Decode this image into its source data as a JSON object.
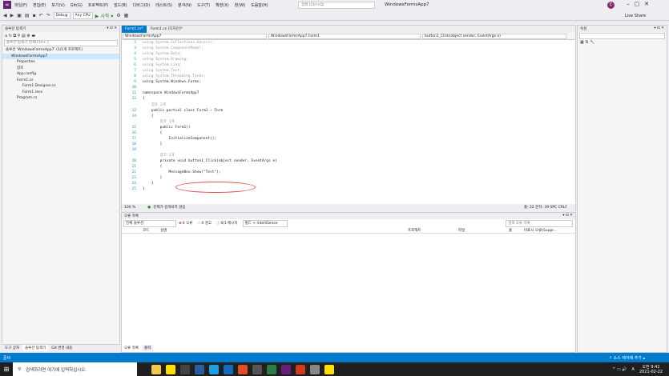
{
  "menu": {
    "items": [
      "파일(F)",
      "편집(E)",
      "보기(V)",
      "Git(G)",
      "프로젝트(P)",
      "빌드(B)",
      "디버그(D)",
      "테스트(S)",
      "분석(N)",
      "도구(T)",
      "확장(X)",
      "창(W)",
      "도움말(H)"
    ],
    "search_placeholder": "검색 (Ctrl+Q)",
    "title": "WindowsFormsApp7",
    "avatar": "C",
    "live_share": "Live Share"
  },
  "toolbar": {
    "config": "Debug",
    "platform": "Any CPU",
    "start": "▶ 시작 ▾"
  },
  "solution_explorer": {
    "title": "솔루션 탐색기",
    "search_placeholder": "솔루션 탐색기 검색(Ctrl+;)",
    "items": [
      {
        "label": "솔루션 'WindowsFormsApp7' (1/1개 프로젝트)",
        "indent": 0,
        "sel": false
      },
      {
        "label": "WindowsFormsApp7",
        "indent": 1,
        "sel": true
      },
      {
        "label": "Properties",
        "indent": 2,
        "sel": false
      },
      {
        "label": "참조",
        "indent": 2,
        "sel": false
      },
      {
        "label": "App.config",
        "indent": 2,
        "sel": false
      },
      {
        "label": "Form1.cs",
        "indent": 2,
        "sel": false
      },
      {
        "label": "Form1.Designer.cs",
        "indent": 3,
        "sel": false
      },
      {
        "label": "Form1.resx",
        "indent": 3,
        "sel": false
      },
      {
        "label": "Program.cs",
        "indent": 2,
        "sel": false
      }
    ],
    "bottom_tabs": [
      "도구 상자",
      "솔루션 탐색기",
      "Git 변경 내용"
    ]
  },
  "editor": {
    "tabs": [
      {
        "label": "Form1.cs*",
        "active": true
      },
      {
        "label": "Form1.cs [디자인]*",
        "active": false
      }
    ],
    "nav": [
      "WindowsFormsApp7",
      "WindowsFormsApp7.Form1",
      "button1_Click(object sender, EventArgs e)"
    ],
    "lines": [
      {
        "n": "2",
        "code": "using System.Collections.Generic;",
        "dim": true
      },
      {
        "n": "3",
        "code": "using System.ComponentModel;",
        "dim": true
      },
      {
        "n": "4",
        "code": "using System.Data;",
        "dim": true
      },
      {
        "n": "5",
        "code": "using System.Drawing;",
        "dim": true
      },
      {
        "n": "6",
        "code": "using System.Linq;",
        "dim": true
      },
      {
        "n": "7",
        "code": "using System.Text;",
        "dim": true
      },
      {
        "n": "8",
        "code": "using System.Threading.Tasks;",
        "dim": true
      },
      {
        "n": "9",
        "code": "using System.Windows.Forms;",
        "dim": false
      },
      {
        "n": "10",
        "code": "",
        "dim": false
      },
      {
        "n": "11",
        "code": "namespace WindowsFormsApp7",
        "dim": false
      },
      {
        "n": "12",
        "code": "{",
        "dim": false
      },
      {
        "n": "",
        "code": "    참조 2개",
        "dim": true
      },
      {
        "n": "13",
        "code": "    public partial class Form1 : Form",
        "dim": false
      },
      {
        "n": "14",
        "code": "    {",
        "dim": false
      },
      {
        "n": "",
        "code": "        참조 1개",
        "dim": true
      },
      {
        "n": "15",
        "code": "        public Form1()",
        "dim": false
      },
      {
        "n": "16",
        "code": "        {",
        "dim": false
      },
      {
        "n": "17",
        "code": "            InitializeComponent();",
        "dim": false
      },
      {
        "n": "18",
        "code": "        }",
        "dim": false
      },
      {
        "n": "19",
        "code": "",
        "dim": false
      },
      {
        "n": "",
        "code": "        참조 1개",
        "dim": true
      },
      {
        "n": "20",
        "code": "        private void button1_Click(object sender, EventArgs e)",
        "dim": false
      },
      {
        "n": "21",
        "code": "        {",
        "dim": false
      },
      {
        "n": "22",
        "code": "            MessageBox.Show(\"Test\");",
        "dim": false
      },
      {
        "n": "23",
        "code": "        }",
        "dim": false
      },
      {
        "n": "24",
        "code": "    }",
        "dim": false
      },
      {
        "n": "25",
        "code": "}",
        "dim": false
      }
    ],
    "zoom": "100 %",
    "issues": "문제가 검색되지 않음",
    "pos": "줄: 22   문자: 39   SPC   CRLF"
  },
  "error_list": {
    "title": "오류 목록",
    "scope": "전체 솔루션",
    "errors": "0 오류",
    "warnings": "0 경고",
    "messages": "0/1 메시지",
    "build": "빌드 + IntelliSense",
    "search": "검색 오류 목록",
    "columns": [
      "코드",
      "설명",
      "프로젝트",
      "파일",
      "줄",
      "비표시 오류(Suppr..."
    ],
    "bottom_tabs": [
      "오류 목록",
      "출력"
    ]
  },
  "properties": {
    "title": "속성"
  },
  "status": {
    "left": "준비",
    "right": "↑ 소스 제어에 추가 ▴"
  },
  "taskbar": {
    "search": "검색하려면 여기에 입력하십시오.",
    "time": "오전 9:42",
    "date": "2021-02-22",
    "lang": "A"
  }
}
